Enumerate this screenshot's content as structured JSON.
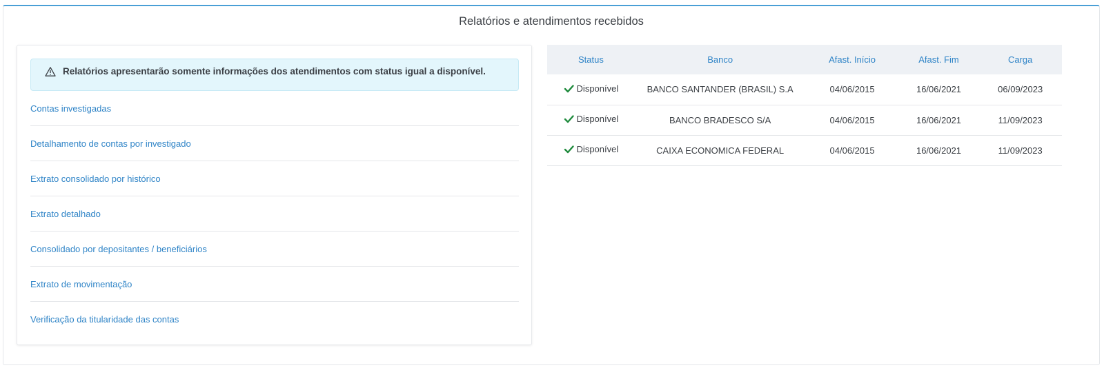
{
  "title": "Relatórios e atendimentos recebidos",
  "alert": {
    "icon": "warning-triangle-icon",
    "text": "Relatórios apresentarão somente informações dos atendimentos com status igual a disponível."
  },
  "reports": [
    {
      "label": "Contas investigadas"
    },
    {
      "label": "Detalhamento de contas por investigado"
    },
    {
      "label": "Extrato consolidado por histórico"
    },
    {
      "label": "Extrato detalhado"
    },
    {
      "label": "Consolidado por depositantes / beneficiários"
    },
    {
      "label": "Extrato de movimentação"
    },
    {
      "label": "Verificação da titularidade das contas"
    }
  ],
  "table": {
    "headers": {
      "status": "Status",
      "banco": "Banco",
      "inicio": "Afast. Início",
      "fim": "Afast. Fim",
      "carga": "Carga"
    },
    "rows": [
      {
        "status": "Disponível",
        "banco": "BANCO SANTANDER (BRASIL) S.A",
        "inicio": "04/06/2015",
        "fim": "16/06/2021",
        "carga": "06/09/2023"
      },
      {
        "status": "Disponível",
        "banco": "BANCO BRADESCO S/A",
        "inicio": "04/06/2015",
        "fim": "16/06/2021",
        "carga": "11/09/2023"
      },
      {
        "status": "Disponível",
        "banco": "CAIXA ECONOMICA FEDERAL",
        "inicio": "04/06/2015",
        "fim": "16/06/2021",
        "carga": "11/09/2023"
      }
    ]
  },
  "colors": {
    "accent": "#4a9fd6",
    "link": "#2f84c7",
    "alert_bg": "#e3f6fc",
    "status_ok": "#1e8a3c"
  }
}
